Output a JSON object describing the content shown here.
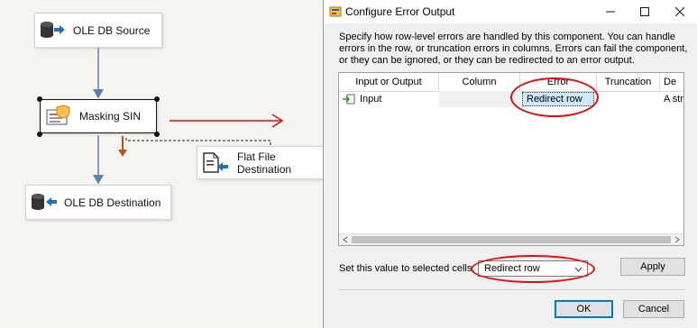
{
  "designer": {
    "nodes": {
      "source": "OLE DB Source",
      "masking": "Masking SIN",
      "flat_file": "Flat File Destination",
      "destination": "OLE DB Destination"
    }
  },
  "dialog": {
    "title": "Configure Error Output",
    "description": "Specify how row-level errors are handled by this component. You can handle errors in the row, or truncation errors in columns. Errors can fail the component, or they can be ignored, or they can be redirected to an error output.",
    "grid": {
      "headers": [
        "Input or Output",
        "Column",
        "Error",
        "Truncation",
        "De"
      ],
      "row": {
        "input_or_output": "Input",
        "column": "",
        "error": "Redirect row",
        "truncation": "",
        "description": "A stri"
      }
    },
    "set_value_label": "Set this value to selected cells:",
    "set_value_select": "Redirect row",
    "apply_label": "Apply",
    "ok_label": "OK",
    "cancel_label": "Cancel"
  },
  "colors": {
    "annotation": "#e01010",
    "selection": "#cde8ff"
  }
}
